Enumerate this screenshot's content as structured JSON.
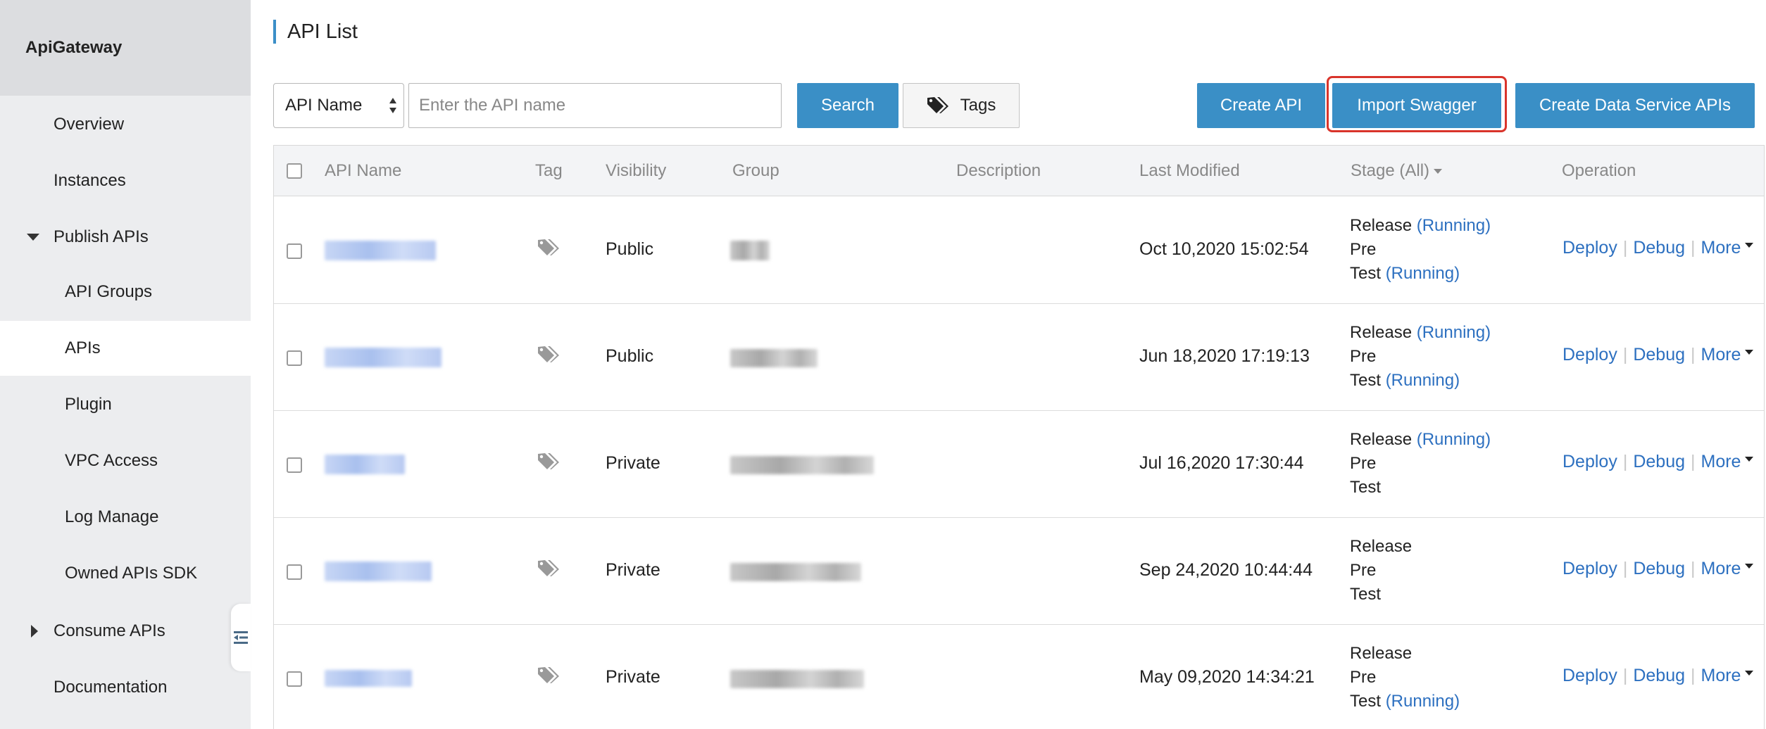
{
  "app": {
    "brand": "ApiGateway"
  },
  "sidebar": {
    "items": [
      {
        "label": "Overview"
      },
      {
        "label": "Instances"
      },
      {
        "label": "Publish APIs"
      },
      {
        "label": "API Groups"
      },
      {
        "label": "APIs",
        "active": true
      },
      {
        "label": "Plugin"
      },
      {
        "label": "VPC Access"
      },
      {
        "label": "Log Manage"
      },
      {
        "label": "Owned APIs SDK"
      },
      {
        "label": "Consume APIs"
      },
      {
        "label": "Documentation"
      }
    ],
    "collapse_icon": "collapse-menu-icon"
  },
  "page": {
    "title": "API List"
  },
  "toolbar": {
    "filter_select": "API Name",
    "search_placeholder": "Enter the API name",
    "search_label": "Search",
    "tags_label": "Tags",
    "tags_icon": "tags-icon",
    "create_api_label": "Create API",
    "import_swagger_label": "Import Swagger",
    "create_data_service_label": "Create Data Service APIs",
    "highlight_color": "#d9342b"
  },
  "table": {
    "columns": {
      "api_name": "API Name",
      "tag": "Tag",
      "visibility": "Visibility",
      "group": "Group",
      "description": "Description",
      "last_modified": "Last Modified",
      "stage": "Stage (All)",
      "operation": "Operation"
    },
    "stage_labels": {
      "release": "Release",
      "pre": "Pre",
      "test": "Test",
      "running": "(Running)"
    },
    "operation_labels": {
      "deploy": "Deploy",
      "debug": "Debug",
      "more": "More"
    },
    "rows": [
      {
        "visibility": "Public",
        "last_modified": "Oct 10,2020 15:02:54",
        "release_running": true,
        "test_running": true
      },
      {
        "visibility": "Public",
        "last_modified": "Jun 18,2020 17:19:13",
        "release_running": true,
        "test_running": true
      },
      {
        "visibility": "Private",
        "last_modified": "Jul 16,2020 17:30:44",
        "release_running": true,
        "test_running": false
      },
      {
        "visibility": "Private",
        "last_modified": "Sep 24,2020 10:44:44",
        "release_running": false,
        "test_running": false
      },
      {
        "visibility": "Private",
        "last_modified": "May 09,2020 14:34:21",
        "release_running": false,
        "test_running": true
      }
    ]
  },
  "colors": {
    "primary": "#3a8fc6",
    "link": "#2d70c0",
    "sidebar_bg": "#ecedef"
  }
}
